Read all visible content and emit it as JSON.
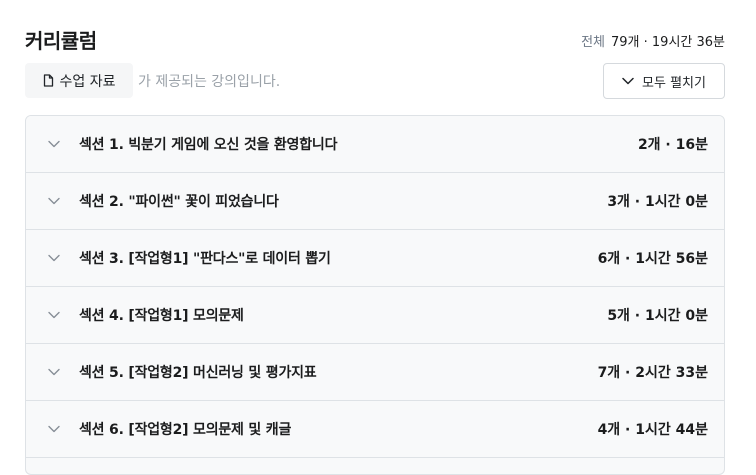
{
  "header": {
    "title": "커리큘럼",
    "total_label": "전체",
    "total_value": "79개 · 19시간 36분"
  },
  "material": {
    "button_label": "수업 자료",
    "note": "가 제공되는 강의입니다."
  },
  "expand": {
    "label": "모두 펼치기"
  },
  "sections": [
    {
      "title": "섹션 1. 빅분기 게임에 오신 것을 환영합니다",
      "meta": "2개 · 16분"
    },
    {
      "title": "섹션 2. \"파이썬\" 꽃이 피었습니다",
      "meta": "3개 · 1시간 0분"
    },
    {
      "title": "섹션 3. [작업형1] \"판다스\"로 데이터 뽑기",
      "meta": "6개 · 1시간 56분"
    },
    {
      "title": "섹션 4. [작업형1] 모의문제",
      "meta": "5개 · 1시간 0분"
    },
    {
      "title": "섹션 5. [작업형2] 머신러닝 및 평가지표",
      "meta": "7개 · 2시간 33분"
    },
    {
      "title": "섹션 6. [작업형2] 모의문제 및 캐글",
      "meta": "4개 · 1시간 44분"
    }
  ]
}
